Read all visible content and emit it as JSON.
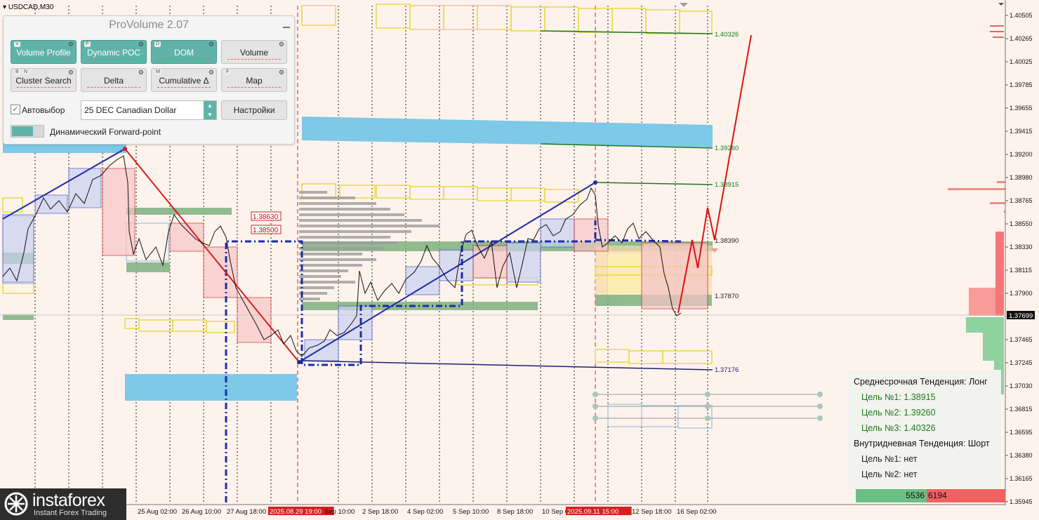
{
  "chart": {
    "symbol_label": "USDCAD,M30",
    "price_ticks": [
      "1.40505",
      "1.40265",
      "1.40025",
      "1.39785",
      "1.39655",
      "1.39415",
      "1.39200",
      "1.38980",
      "1.38765",
      "1.38550",
      "1.38330",
      "1.38115",
      "1.37900",
      "1.37699",
      "1.37465",
      "1.37245",
      "1.37030",
      "1.36815",
      "1.36595",
      "1.36380",
      "1.36165",
      "1.35945"
    ],
    "current_price": "1.37699",
    "time_labels": [
      "25 Aug 02:00",
      "26 Aug 10:00",
      "27 Aug 18:00",
      "2025.08.29 19:00",
      "Sep 10:00",
      "2 Sep 18:00",
      "4 Sep 02:00",
      "5 Sep 10:00",
      "8 Sep 18:00",
      "10 Sep 0",
      "2025.09.11 15:00",
      "12 Sep 18:00",
      "16 Sep 02:00"
    ],
    "level_labels": [
      "1.40326",
      "1.39260",
      "1.38915",
      "1.38390",
      "1.37870",
      "1.37176"
    ],
    "box_labels": [
      "1.38630",
      "1.38500"
    ],
    "colors": {
      "background": "#fdf3ec",
      "up_trend": "#1f2aa8",
      "down_trend": "#d42020",
      "forecast": "#e01010",
      "level_green": "#1a7a1a",
      "zone_blue": "#7ec8e8",
      "zone_green": "#7fb07f",
      "box_yellow": "#e6d21a"
    }
  },
  "panel": {
    "title": "ProVolume 2.07",
    "modules": [
      {
        "key": "V",
        "key2": "",
        "label": "Volume Profile",
        "active": true
      },
      {
        "key": "P",
        "key2": "",
        "label": "Dynamic POC",
        "active": true
      },
      {
        "key": "D",
        "key2": "",
        "label": "DOM",
        "active": true
      },
      {
        "key": "",
        "key2": "",
        "label": "Volume",
        "active": false
      },
      {
        "key": "B",
        "key2": "N",
        "label": "Cluster Search",
        "active": false
      },
      {
        "key": "",
        "key2": "",
        "label": "Delta",
        "active": false
      },
      {
        "key": "M",
        "key2": "",
        "label": "Cumulative Δ",
        "active": false
      },
      {
        "key": "F",
        "key2": "",
        "label": "Map",
        "active": false
      }
    ],
    "auto_select_label": "Автовыбор",
    "auto_select_checked": true,
    "instrument": "25 DEC Canadian Dollar",
    "settings_label": "Настройки",
    "forward_point_label": "Динамический Forward-point"
  },
  "trend": {
    "mid_title": "Среднесрочная Тенденция: Лонг",
    "mid_targets": [
      "Цель №1: 1.38915",
      "Цель №2: 1.39260",
      "Цель №3: 1.40326"
    ],
    "intraday_title": "Внутридневная Тенденция: Шорт",
    "intraday_targets": [
      "Цель №1: нет",
      "Цель №2: нет"
    ]
  },
  "volume_balance": {
    "buy": "5536",
    "sell": "6194"
  },
  "branding": {
    "name": "instaforex",
    "tagline": "Instant Forex Trading"
  }
}
